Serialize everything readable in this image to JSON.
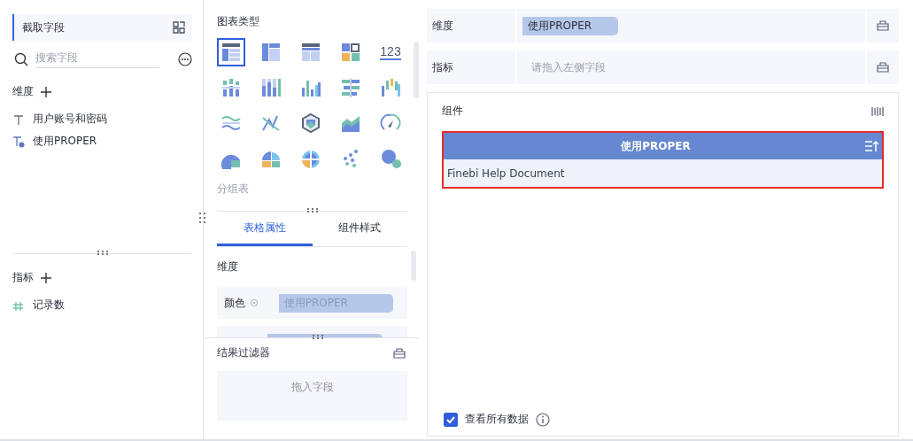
{
  "left": {
    "header": "截取字段",
    "search": {
      "placeholder": "搜索字段"
    },
    "dimensions": {
      "title": "维度",
      "items": [
        {
          "label": "用户账号和密码",
          "kind": "text"
        },
        {
          "label": "使用PROPER",
          "kind": "formula"
        }
      ]
    },
    "measures": {
      "title": "指标",
      "items": [
        {
          "label": "记录数",
          "kind": "number"
        }
      ]
    }
  },
  "chart_panel": {
    "title": "图表类型",
    "types": [
      {
        "selected": true
      },
      {
        "selected": false
      },
      {
        "selected": false
      },
      {
        "selected": false
      },
      {
        "selected": false
      },
      {
        "selected": false
      },
      {
        "selected": false
      },
      {
        "selected": false
      },
      {
        "selected": false
      },
      {
        "selected": false
      },
      {
        "selected": false
      },
      {
        "selected": false
      },
      {
        "selected": false
      },
      {
        "selected": false
      },
      {
        "selected": false
      },
      {
        "selected": false
      },
      {
        "selected": false
      },
      {
        "selected": false
      },
      {
        "selected": false
      },
      {
        "selected": false
      }
    ],
    "number_label": "123",
    "caption": "分组表"
  },
  "tabs": [
    {
      "label": "表格属性",
      "selected": true
    },
    {
      "label": "组件样式",
      "selected": false
    }
  ],
  "properties": {
    "title": "维度",
    "rows": [
      {
        "label": "颜色",
        "chip": "使用PROPER"
      }
    ]
  },
  "result_filter": {
    "title": "结果过滤器",
    "hint": "拖入字段"
  },
  "shelves": [
    {
      "label": "维度",
      "chip": "使用PROPER"
    },
    {
      "label": "指标",
      "hint": "请拖入左侧字段"
    }
  ],
  "component": {
    "title": "组件",
    "table": {
      "columns": [
        "使用PROPER"
      ],
      "rows": [
        [
          "Finebi Help Document"
        ]
      ]
    },
    "view_all": {
      "label": "查看所有数据",
      "checked": true
    }
  }
}
